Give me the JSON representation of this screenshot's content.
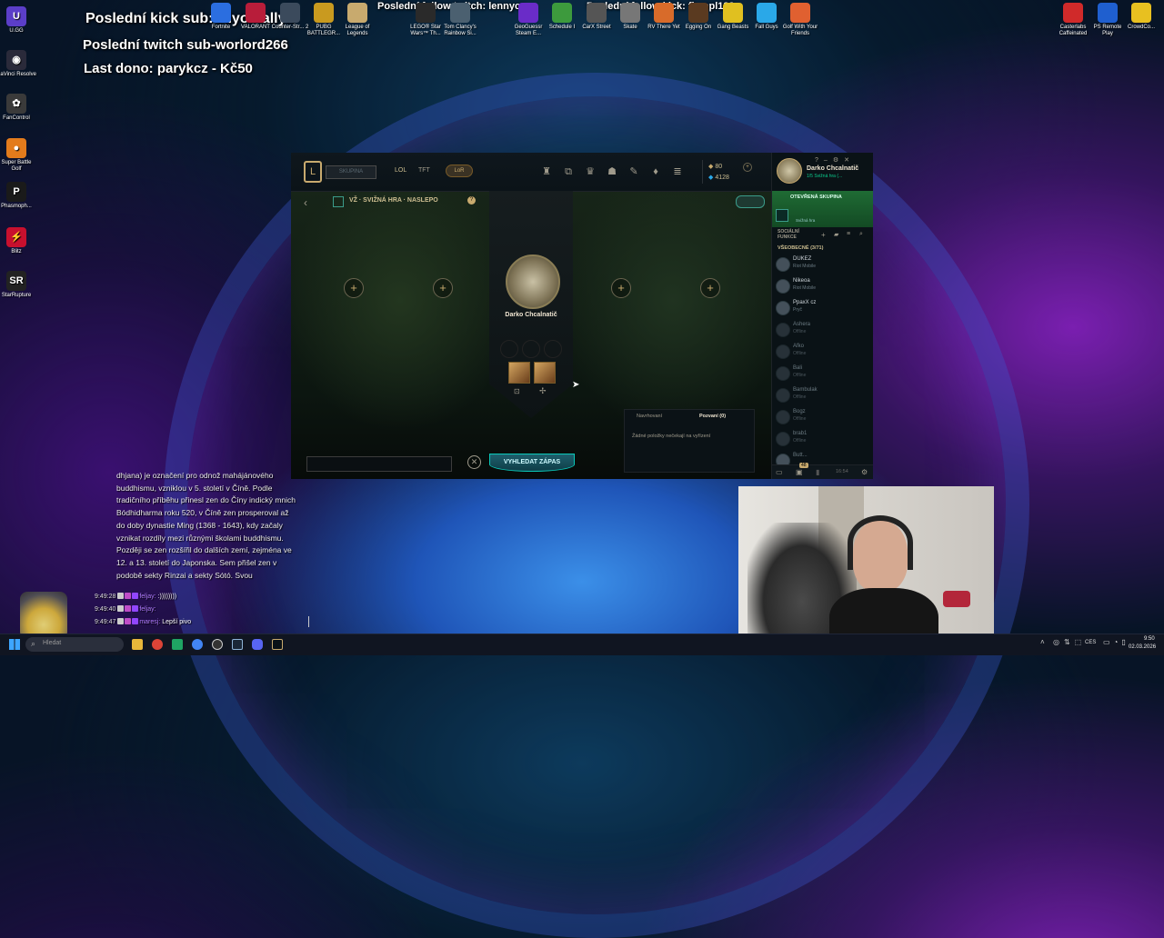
{
  "overlay": {
    "last_kick_sub": "Poslední kick sub: Kiyomallyx",
    "last_twitch_sub": "Poslední twitch sub-worlord266",
    "last_dono": "Last dono: parykcz - Kč50",
    "last_follow_twitch": "Poslední follow twitch: lennycz",
    "last_follow_kick": "Poslední follow kick: flempl123"
  },
  "desktop_left_icons": [
    {
      "label": "U.GG",
      "icon": "ugg-icon",
      "glyph": "U",
      "color": "#5b3ec8"
    },
    {
      "label": "DaVinci Resolve",
      "icon": "davinci-icon",
      "glyph": "◉",
      "color": "#2a2a3a"
    },
    {
      "label": "FanControl",
      "icon": "fan-icon",
      "glyph": "✿",
      "color": "#3a3a3a"
    },
    {
      "label": "Super Battle Golf",
      "icon": "golf-icon",
      "glyph": "●",
      "color": "#e37b1c"
    },
    {
      "label": "Phasmoph...",
      "icon": "phasmophobia-icon",
      "glyph": "P",
      "color": "#1a1a1a"
    },
    {
      "label": "Blitz",
      "icon": "blitz-icon",
      "glyph": "⚡",
      "color": "#c8102e"
    },
    {
      "label": "StarRupture",
      "icon": "starrupture-icon",
      "glyph": "SR",
      "color": "#222"
    }
  ],
  "desktop_top_icons": [
    {
      "label": "Fortnite",
      "icon": "fortnite-icon",
      "color": "#2b6ee0"
    },
    {
      "label": "VALORANT",
      "icon": "valorant-icon",
      "color": "#b81d3a"
    },
    {
      "label": "Counter-Str... 2",
      "icon": "cs2-icon",
      "color": "#3b4a5c"
    },
    {
      "label": "PUBG BATTLEGR...",
      "icon": "pubg-icon",
      "color": "#c99a1f"
    },
    {
      "label": "League of Legends",
      "icon": "lol-icon",
      "color": "#c8aa6e"
    },
    {
      "label": "LEGO® Star Wars™ Th...",
      "icon": "lego-starwars-icon",
      "color": "#2a2a2a"
    },
    {
      "label": "Tom Clancy's Rainbow Si...",
      "icon": "rainbow-six-icon",
      "color": "#4b6070"
    },
    {
      "label": "GeoGuessr Steam E...",
      "icon": "geoguessr-icon",
      "color": "#6a2cc8"
    },
    {
      "label": "Schedule I",
      "icon": "schedule-icon",
      "color": "#3d9a3d"
    },
    {
      "label": "CarX Street",
      "icon": "carx-icon",
      "color": "#555"
    },
    {
      "label": "Skate",
      "icon": "skate-icon",
      "color": "#777"
    },
    {
      "label": "RV There Yet",
      "icon": "rv-icon",
      "color": "#d86b2a"
    },
    {
      "label": "Egging On",
      "icon": "egging-icon",
      "color": "#5a3a20"
    },
    {
      "label": "Gang Beasts",
      "icon": "gangbeasts-icon",
      "color": "#e0c020"
    },
    {
      "label": "Fall Guys",
      "icon": "fallguys-icon",
      "color": "#2aa8e8"
    },
    {
      "label": "Golf With Your Friends",
      "icon": "golf-friends-icon",
      "color": "#e06030"
    }
  ],
  "desktop_right_icons": [
    {
      "label": "Casterlabs Caffeinated",
      "icon": "casterlabs-icon",
      "color": "#d02a2a"
    },
    {
      "label": "PS Remote Play",
      "icon": "ps-remote-icon",
      "color": "#1f5fcf"
    },
    {
      "label": "CrowdCo...",
      "icon": "crowdcontrol-icon",
      "color": "#e8c020"
    }
  ],
  "client": {
    "nav": {
      "party": "SKUPINA",
      "lol": "LOL",
      "tft": "TFT",
      "lor": "LoR"
    },
    "currency": {
      "rp": "80",
      "be": "4128"
    },
    "profile": {
      "name": "Darko Chcalnatič",
      "status": "1/5 Svižná hra (..."
    },
    "lobby": {
      "title": "VŽ · SVIŽNÁ HRA · NASLEPO",
      "player_name": "Darko Chcalnatič",
      "find_match": "VYHLEDAT ZÁPAS"
    },
    "invites": {
      "tab_suggested": "Navrhovaní",
      "tab_invited": "Pozvaní (0)",
      "empty": "Žádné položky nečekají na vyřízení"
    },
    "social": {
      "open_party": "OTEVŘENÁ SKUPINA",
      "party_sub": "Svižná hra",
      "heading": "SOCIÁLNÍ FUNKCE",
      "group": "VŠEOBECNÉ (3/71)",
      "friends": [
        {
          "name": "DUKEZ",
          "status": "Riot Mobile",
          "color": "#cfd6db"
        },
        {
          "name": "Nikeoa",
          "status": "Riot Mobile",
          "color": "#cfd6db"
        },
        {
          "name": "PpaxX cz",
          "status": "Pryč",
          "color": "#cfd6db"
        },
        {
          "name": "Ashera",
          "status": "Offline",
          "color": "#6b7a82"
        },
        {
          "name": "Afko",
          "status": "Offline",
          "color": "#6b7a82"
        },
        {
          "name": "Bali",
          "status": "Offline",
          "color": "#6b7a82"
        },
        {
          "name": "Bambulak",
          "status": "Offline",
          "color": "#6b7a82"
        },
        {
          "name": "Bogz",
          "status": "Offline",
          "color": "#6b7a82"
        },
        {
          "name": "brab1",
          "status": "Offline",
          "color": "#6b7a82"
        },
        {
          "name": "Butt...",
          "status": "",
          "color": "#6b7a82"
        }
      ],
      "bottom_time": "16:54",
      "bottom_badge": "48"
    }
  },
  "chat": {
    "message_text": "dhjana) je označení pro odnož mahájánového buddhismu, vzniklou v 5. století v Číně. Podle tradičního příběhu přinesl zen do Číny indický mnich Bódhidharma roku 520, v Číně zen prosperoval až do doby dynastie Ming (1368 - 1643), kdy začaly vznikat rozdíly mezi různými školami buddhismu. Později se zen rozšířil do dalších zemí, zejména ve 12. a 13. století do Japonska. Sem přišel zen v podobě sekty Rinzai a sekty Sótó. Svou",
    "rows": [
      {
        "time": "9:49:28",
        "user": "feljay:",
        "msg": ":))))))))"
      },
      {
        "time": "9:49:40",
        "user": "feljay:",
        "msg": ""
      },
      {
        "time": "9:49:47",
        "user": "maresj:",
        "msg": "Lepší pivo"
      }
    ]
  },
  "taskbar": {
    "search_placeholder": "Hledat",
    "lang": "CES",
    "time": "9:50",
    "date": "02.03.2026"
  }
}
